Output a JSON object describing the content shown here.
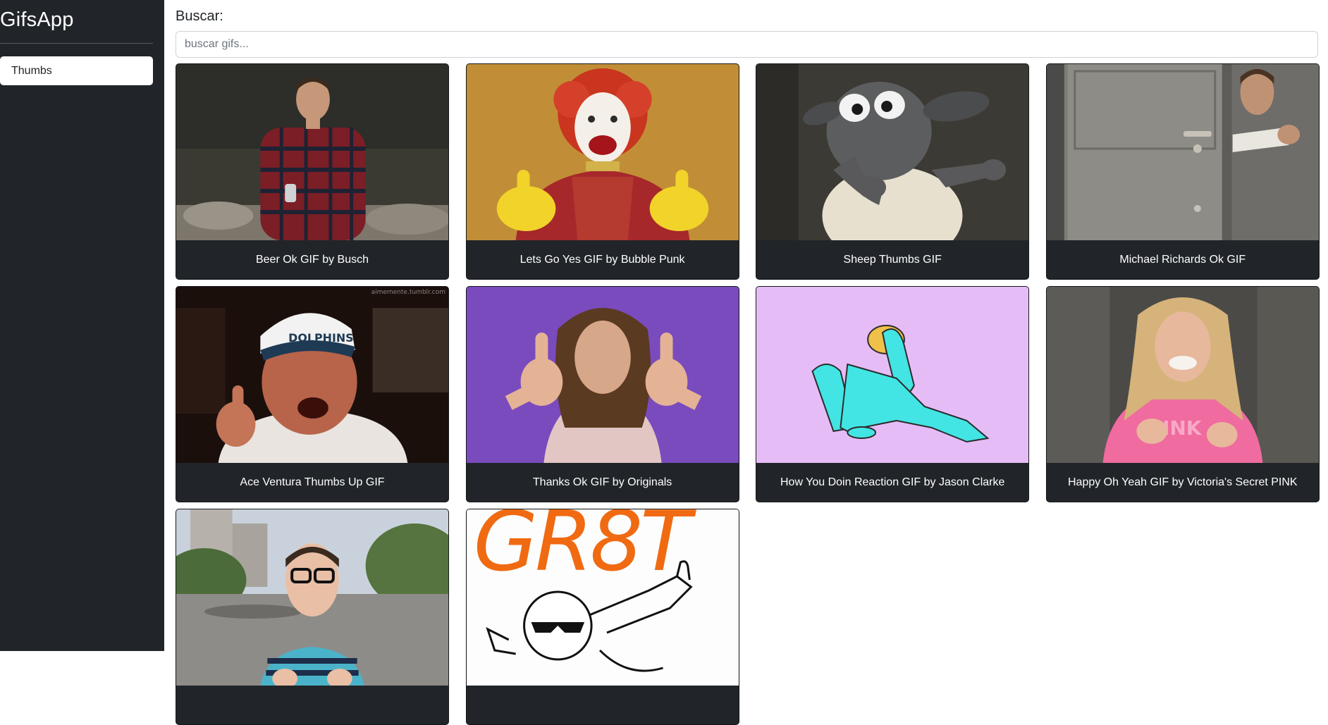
{
  "app": {
    "title": "GifsApp"
  },
  "sidebar": {
    "items": [
      {
        "label": "Thumbs"
      }
    ]
  },
  "search": {
    "label": "Buscar:",
    "placeholder": "buscar gifs...",
    "value": ""
  },
  "gifs": [
    {
      "title": "Beer Ok GIF by Busch"
    },
    {
      "title": "Lets Go Yes GIF by Bubble Punk"
    },
    {
      "title": "Sheep Thumbs GIF"
    },
    {
      "title": "Michael Richards Ok GIF"
    },
    {
      "title": "Ace Ventura Thumbs Up GIF",
      "watermark": "aimemente.tumblr.com"
    },
    {
      "title": "Thanks Ok GIF by Originals"
    },
    {
      "title": "How You Doin Reaction GIF by Jason Clarke"
    },
    {
      "title": "Happy Oh Yeah GIF by Victoria's Secret PINK"
    },
    {
      "title": ""
    },
    {
      "title": "",
      "image_text": "GR8T"
    }
  ],
  "colors": {
    "sidebar_bg": "#212529",
    "card_bg": "#212529",
    "nav_active_bg": "#ffffff"
  }
}
